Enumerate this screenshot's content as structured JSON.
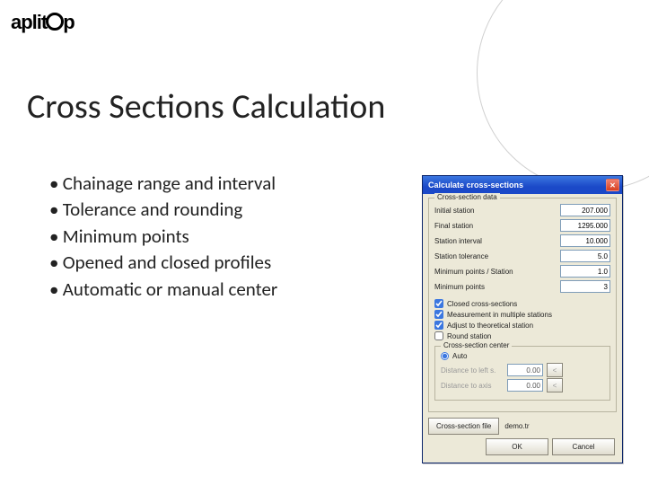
{
  "logo": {
    "part1": "aplit",
    "part2": "p"
  },
  "title": "Cross Sections Calculation",
  "bullets": [
    "Chainage range and interval",
    "Tolerance and rounding",
    "Minimum points",
    "Opened and closed profiles",
    "Automatic or manual center"
  ],
  "dialog": {
    "title": "Calculate cross-sections",
    "group_data": "Cross-section data",
    "fields": {
      "initial_station": {
        "label": "Initial station",
        "value": "207.000"
      },
      "final_station": {
        "label": "Final station",
        "value": "1295.000"
      },
      "station_interval": {
        "label": "Station interval",
        "value": "10.000"
      },
      "station_tolerance": {
        "label": "Station tolerance",
        "value": "5.0"
      },
      "min_points_station": {
        "label": "Minimum points / Station",
        "value": "1.0"
      },
      "min_points": {
        "label": "Minimum points",
        "value": "3"
      }
    },
    "checks": {
      "closed": "Closed cross-sections",
      "multiple": "Measurement in multiple stations",
      "adjust": "Adjust to theoretical station",
      "round": "Round station"
    },
    "center": {
      "legend": "Cross-section center",
      "auto": "Auto",
      "dist_left": {
        "label": "Distance to left s.",
        "value": "0.00"
      },
      "dist_axis": {
        "label": "Distance to axis",
        "value": "0.00"
      }
    },
    "file": {
      "button": "Cross-section file",
      "name": "demo.tr"
    },
    "buttons": {
      "ok": "OK",
      "cancel": "Cancel"
    }
  }
}
